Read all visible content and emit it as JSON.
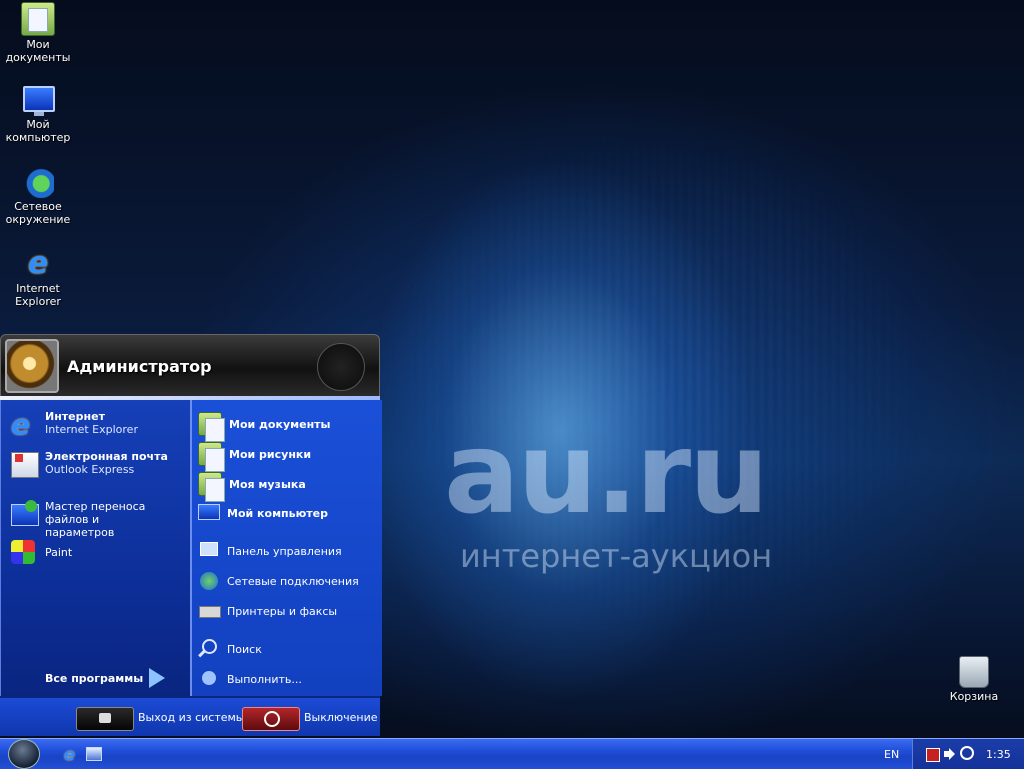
{
  "desktop": {
    "icons": [
      {
        "label_1": "Мои",
        "label_2": "документы",
        "icon": "my-documents-icon"
      },
      {
        "label_1": "Мой",
        "label_2": "компьютер",
        "icon": "my-computer-icon"
      },
      {
        "label_1": "Сетевое",
        "label_2": "окружение",
        "icon": "network-places-icon"
      },
      {
        "label_1": "Internet",
        "label_2": "Explorer",
        "icon": "internet-explorer-icon"
      }
    ],
    "recycle_bin": {
      "label": "Корзина",
      "icon": "recycle-bin-icon"
    },
    "watermark": {
      "brand": "au.ru",
      "tagline": "интернет-аукцион"
    }
  },
  "start_menu": {
    "user_name": "Администратор",
    "left_items": [
      {
        "title": "Интернет",
        "subtitle": "Internet Explorer",
        "icon": "internet-explorer-icon"
      },
      {
        "title": "Электронная почта",
        "subtitle": "Outlook Express",
        "icon": "outlook-express-icon"
      },
      {
        "line_1": "Мастер переноса файлов и",
        "line_2": "параметров",
        "icon": "transfer-wizard-icon"
      },
      {
        "title": "Paint",
        "icon": "paint-icon"
      }
    ],
    "all_programs": "Все программы",
    "right_items": [
      {
        "label": "Мои документы",
        "icon": "my-documents-icon",
        "bold": true
      },
      {
        "label": "Мои рисунки",
        "icon": "my-pictures-icon",
        "bold": true
      },
      {
        "label": "Моя музыка",
        "icon": "my-music-icon",
        "bold": true
      },
      {
        "label": "Мой компьютер",
        "icon": "my-computer-icon",
        "bold": true
      },
      {
        "label": "Панель управления",
        "icon": "control-panel-icon",
        "bold": false
      },
      {
        "label": "Сетевые подключения",
        "icon": "network-connections-icon",
        "bold": false
      },
      {
        "label": "Принтеры и факсы",
        "icon": "printer-icon",
        "bold": false
      },
      {
        "label": "Поиск",
        "icon": "search-icon",
        "bold": false
      },
      {
        "label": "Выполнить...",
        "icon": "run-icon",
        "bold": false
      }
    ],
    "logoff_label": "Выход из системы",
    "shutdown_label": "Выключение"
  },
  "taskbar": {
    "language": "EN",
    "clock": "1:35"
  }
}
